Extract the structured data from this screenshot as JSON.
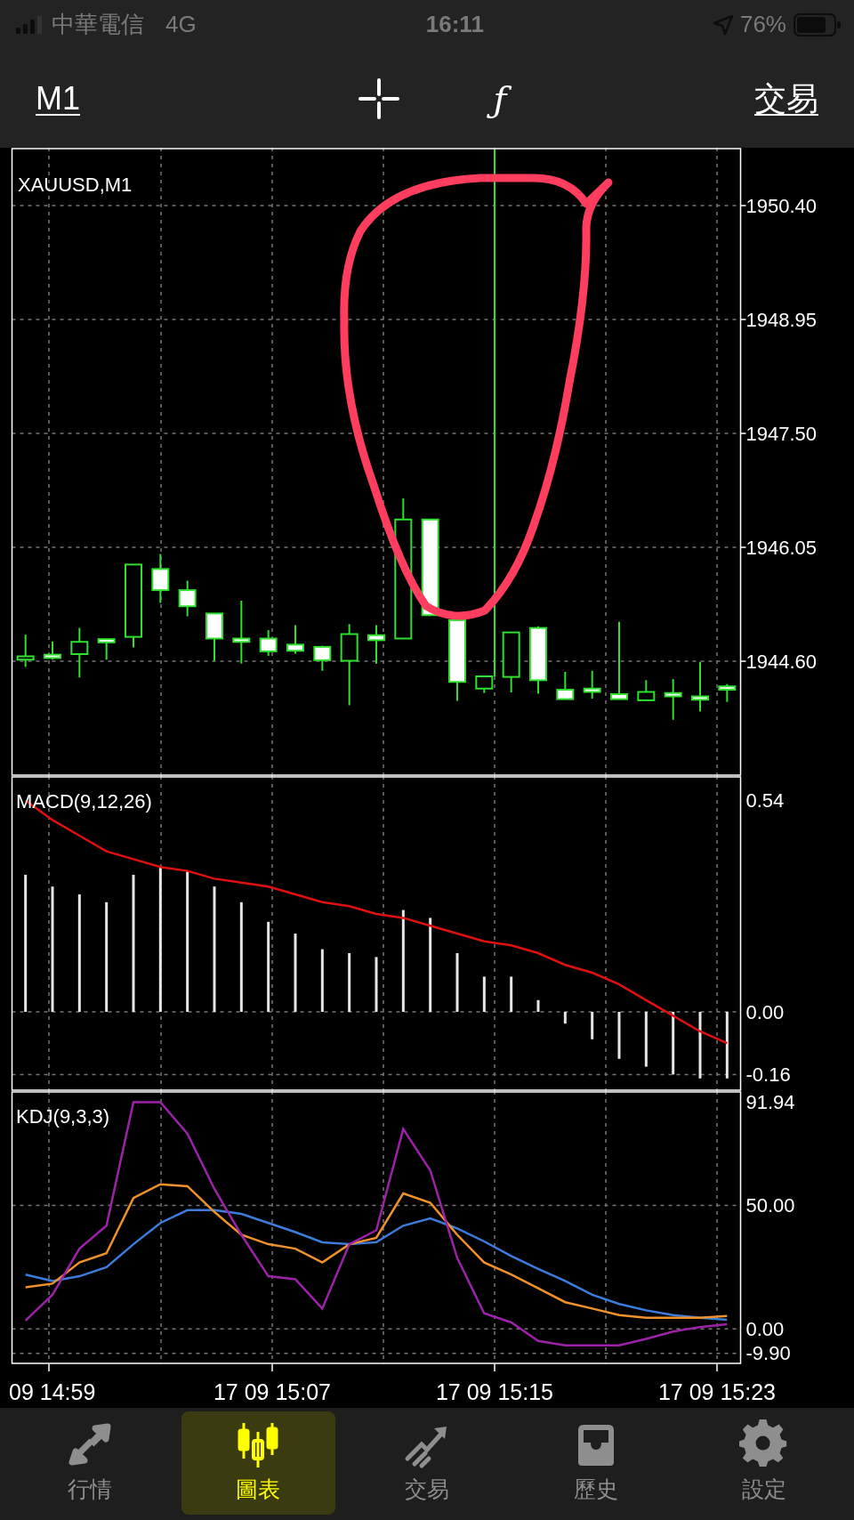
{
  "status_bar": {
    "carrier": "中華電信",
    "network": "4G",
    "time": "16:11",
    "battery": "76%"
  },
  "toolbar": {
    "timeframe": "M1",
    "function_symbol": "ƒ",
    "trade": "交易"
  },
  "price_chart": {
    "title": "XAUUSD,M1",
    "price_labels": [
      "1950.40",
      "1948.95",
      "1947.50",
      "1946.05",
      "1944.60"
    ]
  },
  "macd_chart": {
    "chart_data": {
      "type": "bar",
      "title": "MACD(9,12,26)",
      "grid": true,
      "ylim": [
        -0.2,
        0.6
      ],
      "yticks": [
        {
          "value": 0.54,
          "label": "0.54"
        },
        {
          "value": 0,
          "label": "0.00"
        },
        {
          "value": -0.16,
          "label": "-0.16"
        }
      ],
      "series": [
        {
          "type": "bar",
          "color": "#e6e6e6",
          "values": [
            0.35,
            0.32,
            0.3,
            0.28,
            0.35,
            0.37,
            0.36,
            0.32,
            0.28,
            0.23,
            0.2,
            0.16,
            0.15,
            0.14,
            0.26,
            0.24,
            0.15,
            0.09,
            0.09,
            0.03,
            -0.03,
            -0.07,
            -0.12,
            -0.14,
            -0.16,
            -0.17,
            -0.17
          ]
        },
        {
          "type": "line",
          "color": "#e01010",
          "values": [
            0.54,
            0.49,
            0.45,
            0.41,
            0.39,
            0.37,
            0.36,
            0.34,
            0.33,
            0.32,
            0.3,
            0.28,
            0.27,
            0.25,
            0.24,
            0.22,
            0.2,
            0.18,
            0.17,
            0.15,
            0.12,
            0.1,
            0.07,
            0.03,
            -0.01,
            -0.05,
            -0.08
          ]
        }
      ]
    }
  },
  "kdj_chart": {
    "chart_data": {
      "type": "line",
      "title": "KDJ(9,3,3)",
      "grid": true,
      "ylim": [
        -14,
        96
      ],
      "yticks": [
        {
          "value": 91.94,
          "label": "91.94"
        },
        {
          "value": 50,
          "label": "50.00"
        },
        {
          "value": 0,
          "label": "0.00"
        },
        {
          "value": -9.9,
          "label": "-9.90"
        }
      ],
      "series": [
        {
          "color": "#3c7ddb",
          "values": [
            22.0,
            19.4,
            21.3,
            25.0,
            34.3,
            42.9,
            48.1,
            48.1,
            46.6,
            42.9,
            39.2,
            35.1,
            34.3,
            35.1,
            41.8,
            44.8,
            40.7,
            35.4,
            29.5,
            24.3,
            19.4,
            13.8,
            10.1,
            7.5,
            5.6,
            4.5,
            3.7
          ]
        },
        {
          "color": "#f0922b",
          "values": [
            16.8,
            18.3,
            26.9,
            30.6,
            53.0,
            58.6,
            57.8,
            47.4,
            38.1,
            34.3,
            32.5,
            26.9,
            34.3,
            36.9,
            54.9,
            51.1,
            38.1,
            26.9,
            22.0,
            16.4,
            10.8,
            8.2,
            5.6,
            4.5,
            4.5,
            4.5,
            5.2
          ]
        },
        {
          "color": "#9c22a8",
          "values": [
            3.4,
            13.8,
            32.5,
            41.8,
            91.9,
            91.9,
            79.1,
            56.7,
            38.1,
            21.3,
            20.1,
            8.2,
            34.3,
            39.9,
            81.0,
            64.2,
            28.7,
            6.3,
            2.6,
            -4.9,
            -6.7,
            -6.7,
            -6.7,
            -4.1,
            -1.1,
            0.7,
            1.9
          ]
        }
      ]
    }
  },
  "time_axis": [
    "09 14:59",
    "17 09 15:07",
    "17 09 15:15",
    "17 09 15:23"
  ],
  "tab_bar": [
    {
      "label": "行情",
      "selected": false
    },
    {
      "label": "圖表",
      "selected": true
    },
    {
      "label": "交易",
      "selected": false
    },
    {
      "label": "歷史",
      "selected": false
    },
    {
      "label": "設定",
      "selected": false
    }
  ]
}
